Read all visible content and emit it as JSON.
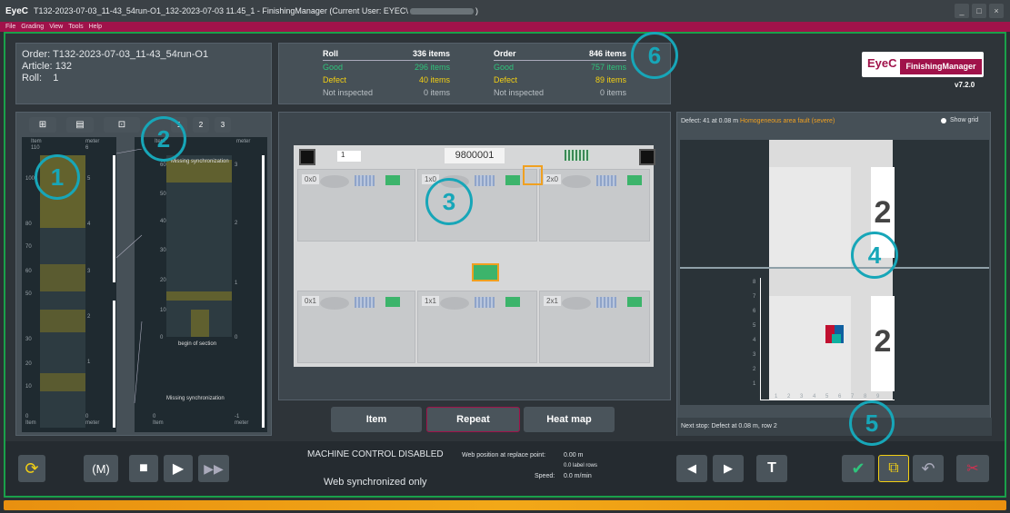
{
  "window": {
    "logo": "EyeC",
    "title": "T132-2023-07-03_11-43_54run-O1_132-2023-07-03 11.45_1 - FinishingManager  (Current User: EYEC\\",
    "title_end": ")",
    "controls": [
      "_",
      "□",
      "×"
    ]
  },
  "menu": [
    "File",
    "Grading",
    "View",
    "Tools",
    "Help"
  ],
  "order_info": {
    "order_label": "Order:",
    "order_value": "T132-2023-07-03_11-43_54run-O1",
    "article_label": "Article:",
    "article_value": "132",
    "roll_label": "Roll:",
    "roll_value": "1"
  },
  "stats": {
    "roll": {
      "title": "Roll",
      "total": "336 items",
      "good_label": "Good",
      "good": "296 items",
      "defect_label": "Defect",
      "defect": "40 items",
      "ni_label": "Not inspected",
      "ni": "0 items"
    },
    "order": {
      "title": "Order",
      "total": "846 items",
      "good_label": "Good",
      "good": "757 items",
      "defect_label": "Defect",
      "defect": "89 items",
      "ni_label": "Not inspected",
      "ni": "0 items"
    }
  },
  "brand": {
    "name": "FinishingManager",
    "version": "v7.2.0",
    "logo": "EyeC"
  },
  "left_panel": {
    "tabs": [
      "1",
      "2",
      "3"
    ],
    "col1_header": {
      "item": "Item",
      "item_val": "110",
      "meter": "meter",
      "meter_val": "6"
    },
    "col2_header": {
      "item": "Item",
      "meter": "meter"
    },
    "col1_footer": {
      "item": "0",
      "item_label": "Item",
      "meter": "0",
      "meter_label": "meter"
    },
    "col2_footer": {
      "item": "0",
      "item_label": "Item",
      "meter": "-1",
      "meter_label": "meter"
    },
    "col1_ticks": [
      "100",
      "80",
      "70",
      "60",
      "50",
      "30",
      "20",
      "10"
    ],
    "col1_meter_ticks": [
      "5",
      "4",
      "3",
      "2",
      "1"
    ],
    "col2_ticks": [
      "60",
      "50",
      "40",
      "30",
      "20",
      "10",
      "0"
    ],
    "col2_meter_ticks": [
      "3",
      "2",
      "1",
      "0"
    ],
    "missing_sync_top": "Missing synchronization",
    "begin_section": "begin of section",
    "missing_sync_bottom": "Missing synchronization"
  },
  "center": {
    "sheet_number": "1",
    "code": "9800001",
    "tiles": [
      "0x0",
      "1x0",
      "2x0",
      "0x1",
      "1x1",
      "2x1"
    ],
    "buttons": {
      "item": "Item",
      "repeat": "Repeat",
      "heatmap": "Heat map"
    }
  },
  "right_panel": {
    "defect_prefix": "Defect: 41 at 0.08 m",
    "defect_type": "Homogeneous area fault (severe)",
    "show_grid": "Show grid",
    "next_stop": "Next stop: Defect at 0.08 m, row 2",
    "y_ticks": [
      "8",
      "7",
      "6",
      "5",
      "4",
      "3",
      "2",
      "1"
    ],
    "x_ticks": [
      "1",
      "2",
      "3",
      "4",
      "5",
      "6",
      "7",
      "8",
      "9"
    ]
  },
  "bottom": {
    "machine": "MACHINE CONTROL DISABLED",
    "sync": "Web synchronized only",
    "web_pos_label": "Web position at replace point:",
    "web_pos": "0.00 m",
    "label_rows": "0.0 label rows",
    "speed_label": "Speed:",
    "speed": "0.0 m/min",
    "text_button": "T"
  },
  "callouts": [
    "1",
    "2",
    "3",
    "4",
    "5",
    "6"
  ],
  "colors": {
    "accent": "#17a6b8",
    "menu": "#a0124a",
    "good": "#2fc47c",
    "defect": "#f2cf14",
    "frame": "#1aa04a"
  }
}
